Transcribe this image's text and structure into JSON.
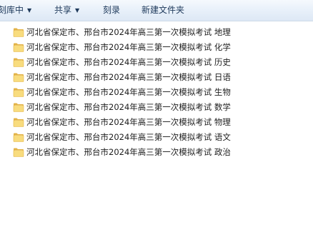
{
  "toolbar": {
    "items": [
      {
        "label": "刻库中",
        "has_dropdown": true
      },
      {
        "label": "共享",
        "has_dropdown": true
      },
      {
        "label": "刻录",
        "has_dropdown": false
      },
      {
        "label": "新建文件夹",
        "has_dropdown": false
      }
    ],
    "dropdown_glyph": "▼"
  },
  "files": [
    {
      "name": "河北省保定市、邢台市2024年高三第一次模拟考试 地理",
      "icon": "folder-icon"
    },
    {
      "name": "河北省保定市、邢台市2024年高三第一次模拟考试 化学",
      "icon": "folder-icon"
    },
    {
      "name": "河北省保定市、邢台市2024年高三第一次模拟考试 历史",
      "icon": "folder-icon"
    },
    {
      "name": "河北省保定市、邢台市2024年高三第一次模拟考试 日语",
      "icon": "folder-icon"
    },
    {
      "name": "河北省保定市、邢台市2024年高三第一次模拟考试 生物",
      "icon": "folder-icon"
    },
    {
      "name": "河北省保定市、邢台市2024年高三第一次模拟考试 数学",
      "icon": "folder-icon"
    },
    {
      "name": "河北省保定市、邢台市2024年高三第一次模拟考试 物理",
      "icon": "folder-icon"
    },
    {
      "name": "河北省保定市、邢台市2024年高三第一次模拟考试 语文",
      "icon": "folder-icon"
    },
    {
      "name": "河北省保定市、邢台市2024年高三第一次模拟考试 政治",
      "icon": "folder-icon"
    }
  ],
  "colors": {
    "toolbar_text": "#1e395b",
    "folder_light": "#f8dc7e",
    "folder_dark": "#e3b347"
  }
}
